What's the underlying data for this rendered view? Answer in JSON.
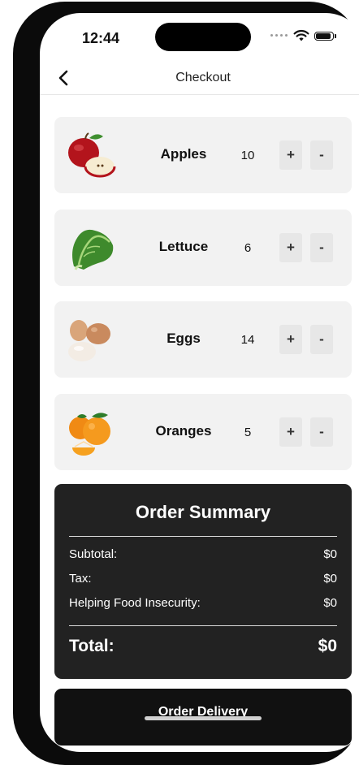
{
  "status_bar": {
    "time": "12:44",
    "signal_icon": "signal-dots-icon",
    "wifi_icon": "wifi-icon",
    "battery_icon": "battery-icon"
  },
  "nav": {
    "title": "Checkout",
    "back_icon": "chevron-left-icon"
  },
  "cart": {
    "items": [
      {
        "name": "Apples",
        "quantity": "10",
        "plus_label": "+",
        "minus_label": "-",
        "image": "apple-image"
      },
      {
        "name": "Lettuce",
        "quantity": "6",
        "plus_label": "+",
        "minus_label": "-",
        "image": "lettuce-image"
      },
      {
        "name": "Eggs",
        "quantity": "14",
        "plus_label": "+",
        "minus_label": "-",
        "image": "eggs-image"
      },
      {
        "name": "Oranges",
        "quantity": "5",
        "plus_label": "+",
        "minus_label": "-",
        "image": "oranges-image"
      }
    ]
  },
  "summary": {
    "title": "Order Summary",
    "subtotal_label": "Subtotal:",
    "subtotal_value": "$0",
    "tax_label": "Tax:",
    "tax_value": "$0",
    "donation_label": "Helping Food Insecurity:",
    "donation_value": "$0",
    "total_label": "Total:",
    "total_value": "$0"
  },
  "delivery": {
    "label": "Order Delivery"
  },
  "colors": {
    "card_bg": "#f2f2f2",
    "summary_bg": "#222222",
    "button_bg": "#111111",
    "qty_button_bg": "#e7e7e7"
  }
}
